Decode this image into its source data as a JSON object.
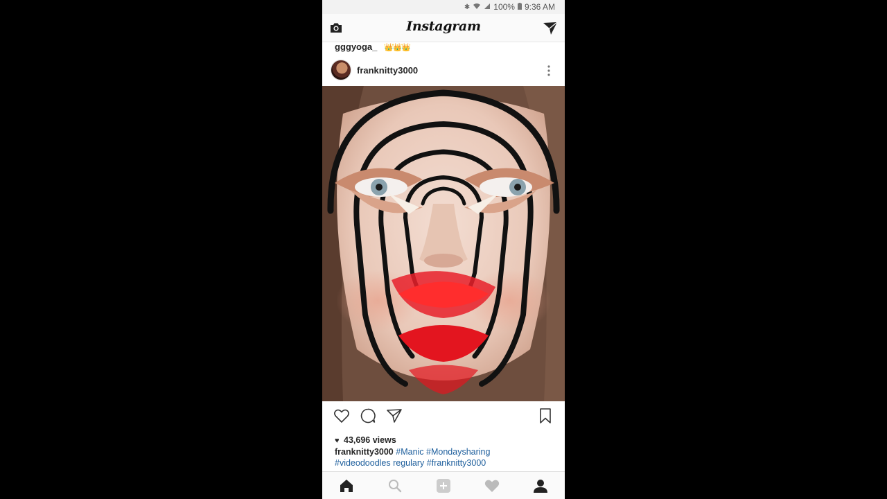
{
  "status_bar": {
    "battery": "100%",
    "time": "9:36 AM",
    "icons": [
      "bluetooth-icon",
      "wifi-icon",
      "signal-icon",
      "battery-icon"
    ]
  },
  "top_nav": {
    "logo": "Instagram",
    "left_icon": "camera-icon",
    "right_icon": "direct-message-icon"
  },
  "previous_post": {
    "caption_user": "gggyoga_",
    "caption_emoji": "👑👑👑"
  },
  "post": {
    "username": "franknitty3000",
    "image_alt": "post-photo",
    "views": "43,696 views",
    "caption_user": "franknitty3000",
    "hashtags_line1": "#Manic #Mondaysharing",
    "caption_line2_tag1": "#videodoodles",
    "caption_line2_word": "regulary",
    "caption_line2_tag2": "#franknitty3000"
  },
  "actions": [
    "like-icon",
    "comment-icon",
    "share-icon",
    "save-icon"
  ],
  "bottom_nav": [
    "home-icon",
    "search-icon",
    "add-post-icon",
    "activity-icon",
    "profile-icon"
  ],
  "colors": {
    "hashtag": "#1d5e9c",
    "text": "#262626",
    "nav_bg": "#fafafa"
  }
}
